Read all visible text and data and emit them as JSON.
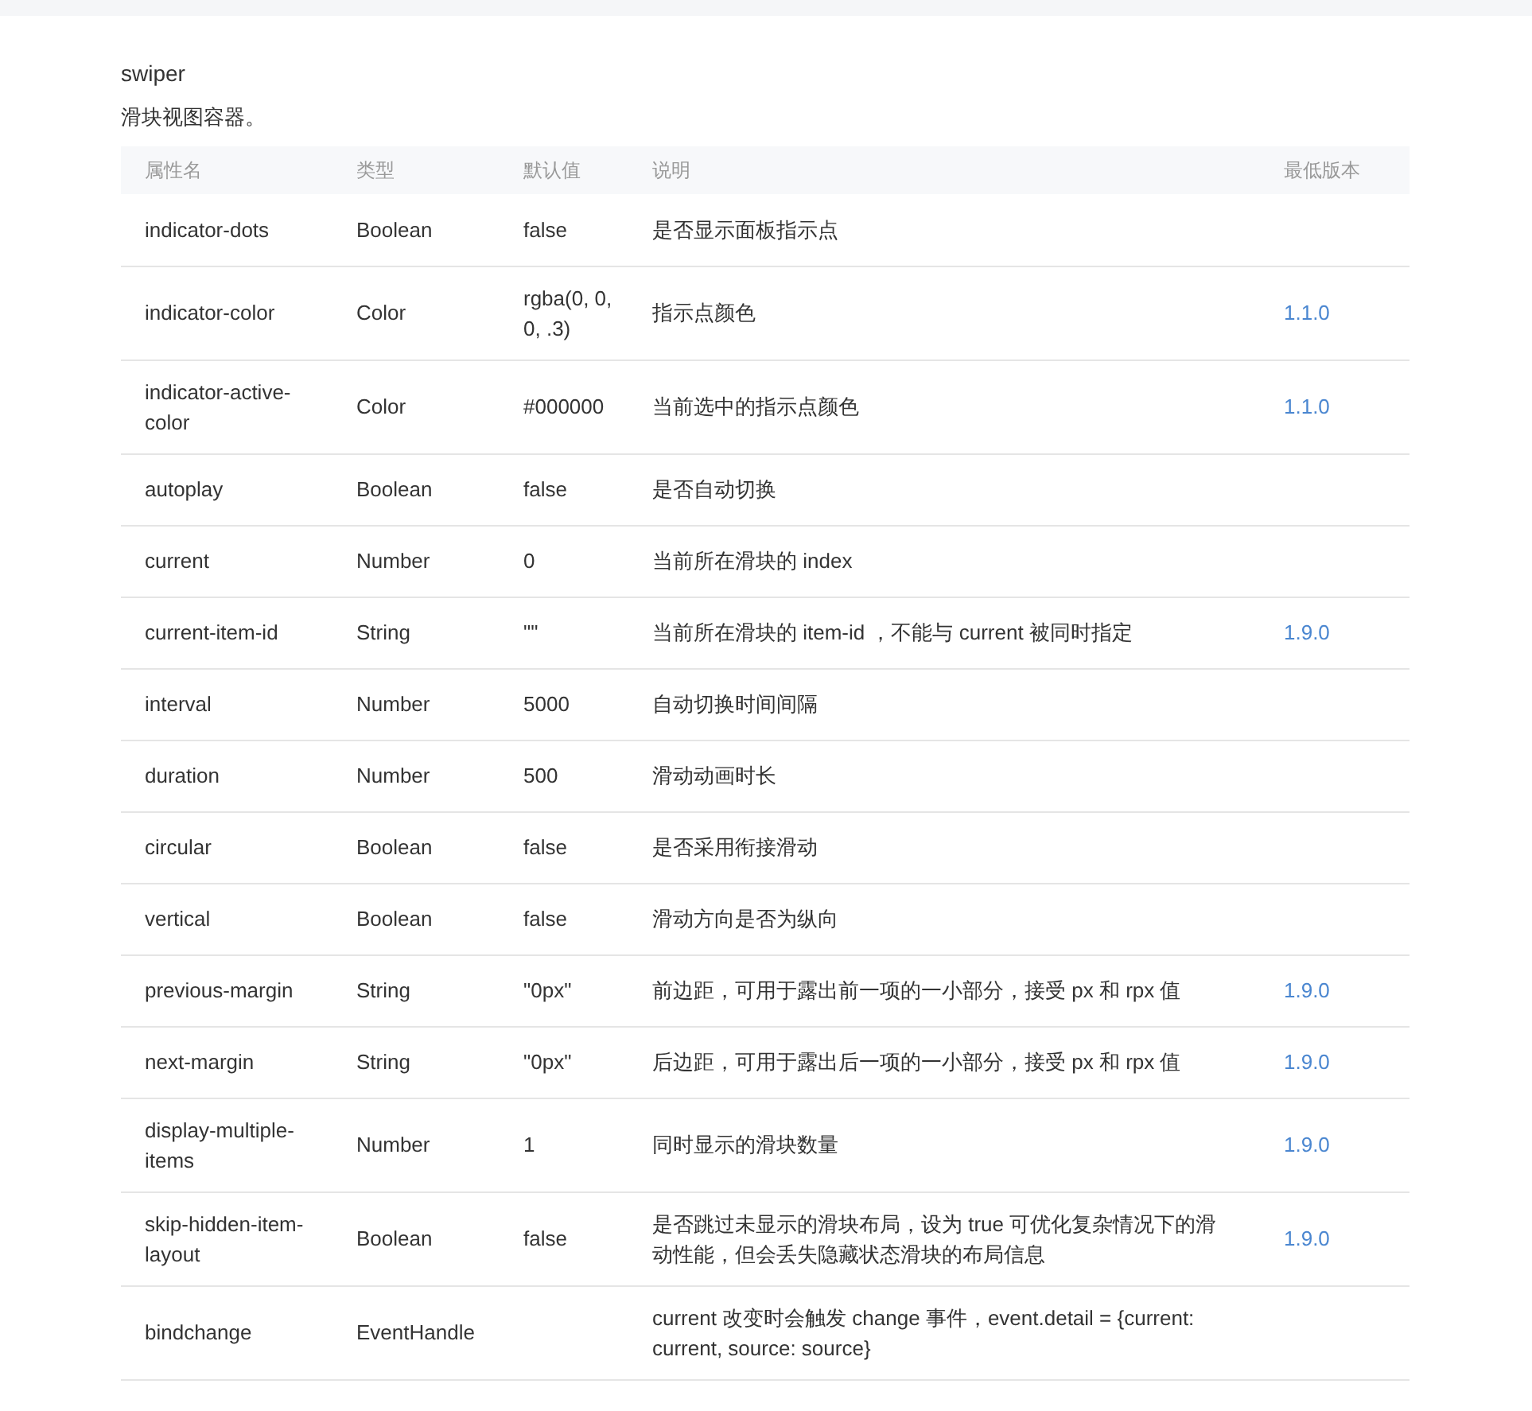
{
  "title": "swiper",
  "description": "滑块视图容器。",
  "table": {
    "columns": [
      "属性名",
      "类型",
      "默认值",
      "说明",
      "最低版本"
    ],
    "rows": [
      {
        "name": "indicator-dots",
        "type": "Boolean",
        "default": "false",
        "description": "是否显示面板指示点"
      },
      {
        "name": "indicator-color",
        "type": "Color",
        "default": "rgba(0, 0, 0, .3)",
        "description": "指示点颜色",
        "version": "1.1.0"
      },
      {
        "name": "indicator-active-color",
        "type": "Color",
        "default": "#000000",
        "description": "当前选中的指示点颜色",
        "version": "1.1.0"
      },
      {
        "name": "autoplay",
        "type": "Boolean",
        "default": "false",
        "description": "是否自动切换"
      },
      {
        "name": "current",
        "type": "Number",
        "default": "0",
        "description": "当前所在滑块的 index"
      },
      {
        "name": "current-item-id",
        "type": "String",
        "default": "\"\"",
        "description": "当前所在滑块的 item-id ，不能与 current 被同时指定",
        "version": "1.9.0"
      },
      {
        "name": "interval",
        "type": "Number",
        "default": "5000",
        "description": "自动切换时间间隔"
      },
      {
        "name": "duration",
        "type": "Number",
        "default": "500",
        "description": "滑动动画时长"
      },
      {
        "name": "circular",
        "type": "Boolean",
        "default": "false",
        "description": "是否采用衔接滑动"
      },
      {
        "name": "vertical",
        "type": "Boolean",
        "default": "false",
        "description": "滑动方向是否为纵向"
      },
      {
        "name": "previous-margin",
        "type": "String",
        "default": "\"0px\"",
        "description": "前边距，可用于露出前一项的一小部分，接受 px 和 rpx 值",
        "version": "1.9.0"
      },
      {
        "name": "next-margin",
        "type": "String",
        "default": "\"0px\"",
        "description": "后边距，可用于露出后一项的一小部分，接受 px 和 rpx 值",
        "version": "1.9.0"
      },
      {
        "name": "display-multiple-items",
        "type": "Number",
        "default": "1",
        "description": "同时显示的滑块数量",
        "version": "1.9.0"
      },
      {
        "name": "skip-hidden-item-layout",
        "type": "Boolean",
        "default": "false",
        "description": "是否跳过未显示的滑块布局，设为 true 可优化复杂情况下的滑动性能，但会丢失隐藏状态滑块的布局信息",
        "version": "1.9.0"
      },
      {
        "name": "bindchange",
        "type": "EventHandle",
        "description": "current 改变时会触发 change 事件，event.detail = {current: current, source: source}"
      }
    ]
  }
}
